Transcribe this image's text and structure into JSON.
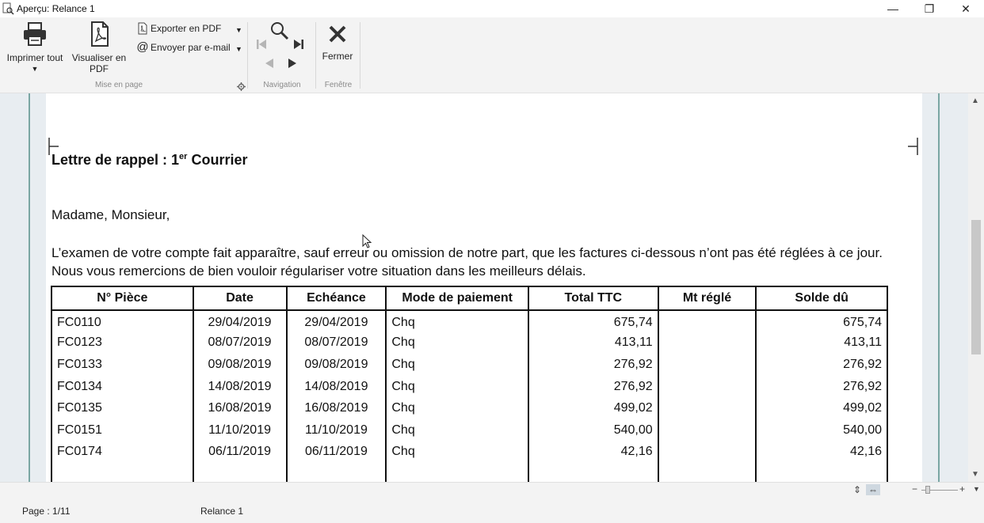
{
  "window": {
    "title": "Aperçu: Relance 1",
    "controls": {
      "minimize": "—",
      "restore": "❐",
      "close": "✕"
    }
  },
  "ribbon": {
    "groups": {
      "mise_en_page": {
        "label": "Mise en page",
        "print_all": "Imprimer tout",
        "view_pdf_line1": "Visualiser en",
        "view_pdf_line2": "PDF",
        "export_pdf": "Exporter en PDF",
        "send_email": "Envoyer par e-mail"
      },
      "navigation": {
        "label": "Navigation"
      },
      "fenetre": {
        "label": "Fenêtre",
        "close": "Fermer"
      }
    },
    "icons": {
      "print": "printer-icon",
      "pdf": "pdf-icon",
      "export": "pdf-file-icon",
      "email": "at-icon",
      "search": "magnifier-icon",
      "first": "first-page-icon",
      "last": "last-page-icon",
      "prev": "previous-page-icon",
      "next": "next-page-icon",
      "close": "close-x-icon",
      "settings": "gear-icon"
    }
  },
  "document": {
    "title_main": "Lettre de rappel : 1",
    "title_sup": "er",
    "title_tail": " Courrier",
    "salutation": "Madame, Monsieur,",
    "paragraph": "L’examen de votre compte fait apparaître, sauf erreur ou omission de notre part, que les factures ci-dessous n’ont pas été réglées à ce jour. Nous vous remercions de bien vouloir régulariser votre situation dans les meilleurs délais.",
    "table": {
      "headers": [
        "N° Pièce",
        "Date",
        "Echéance",
        "Mode de paiement",
        "Total TTC",
        "Mt réglé",
        "Solde dû"
      ],
      "rows": [
        [
          "FC0110",
          "29/04/2019",
          "29/04/2019",
          "Chq",
          "675,74",
          "",
          "675,74"
        ],
        [
          "FC0123",
          "08/07/2019",
          "08/07/2019",
          "Chq",
          "413,11",
          "",
          "413,11"
        ],
        [
          "FC0133",
          "09/08/2019",
          "09/08/2019",
          "Chq",
          "276,92",
          "",
          "276,92"
        ],
        [
          "FC0134",
          "14/08/2019",
          "14/08/2019",
          "Chq",
          "276,92",
          "",
          "276,92"
        ],
        [
          "FC0135",
          "16/08/2019",
          "16/08/2019",
          "Chq",
          "499,02",
          "",
          "499,02"
        ],
        [
          "FC0151",
          "11/10/2019",
          "11/10/2019",
          "Chq",
          "540,00",
          "",
          "540,00"
        ],
        [
          "FC0174",
          "06/11/2019",
          "06/11/2019",
          "Chq",
          "42,16",
          "",
          "42,16"
        ]
      ]
    }
  },
  "statusbar": {
    "page": "Page : 1/11",
    "report": "Relance 1",
    "zoom_minus": "−",
    "zoom_plus": "+"
  }
}
